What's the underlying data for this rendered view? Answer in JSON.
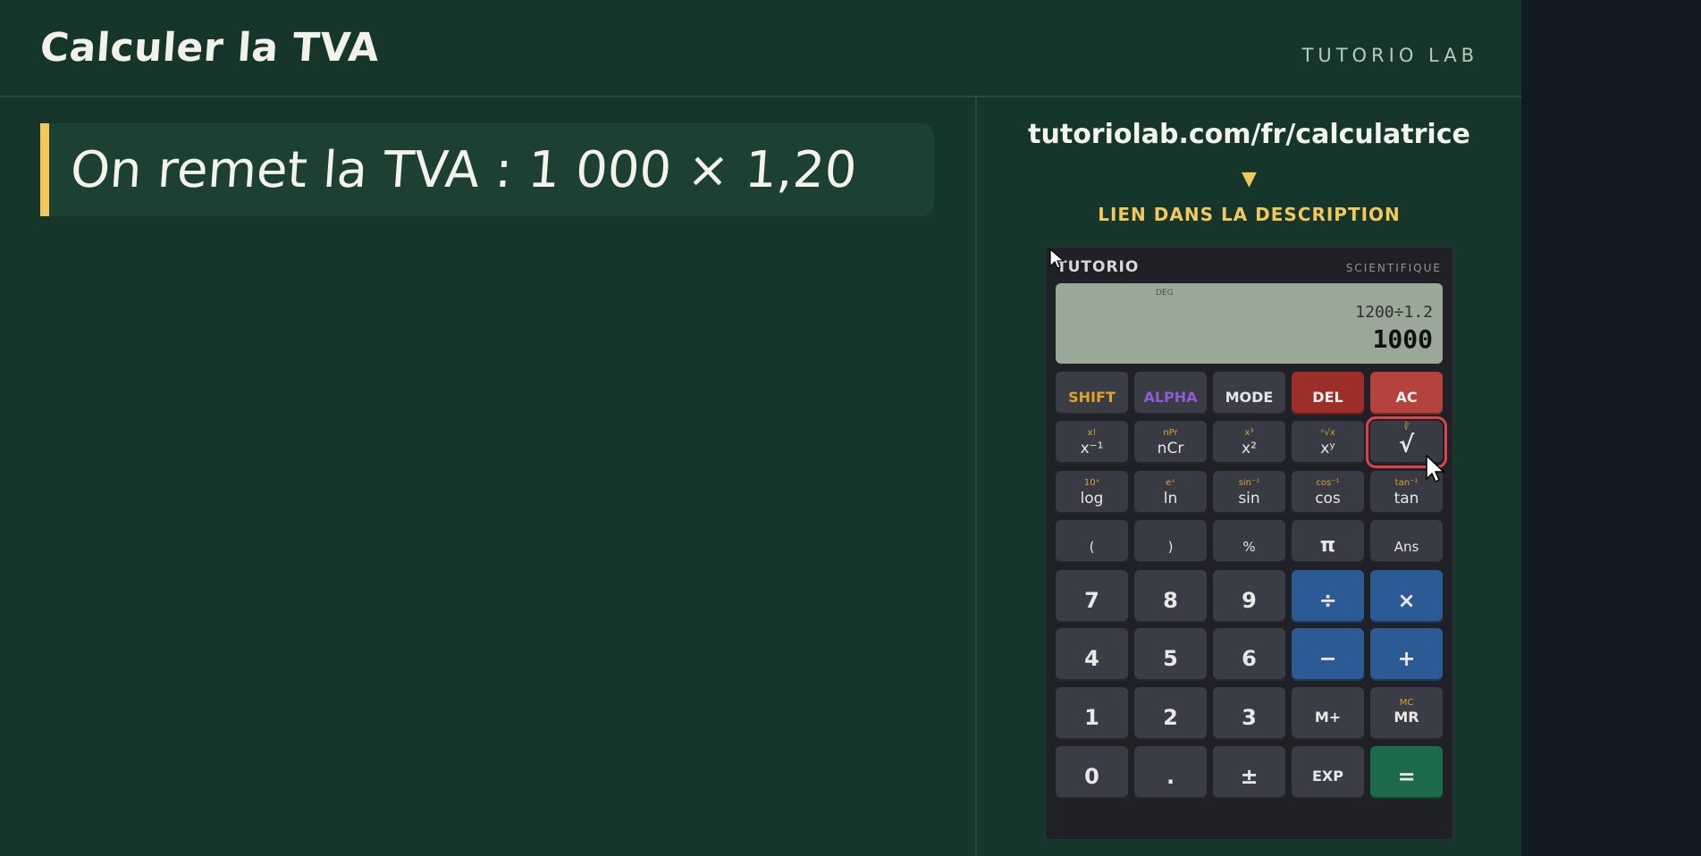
{
  "header": {
    "title": "Calculer la TVA",
    "brand": "TUTORIO LAB"
  },
  "step": {
    "text": "On remet la TVA : 1 000 × 1,20"
  },
  "promo": {
    "url": "tutoriolab.com/fr/calculatrice",
    "arrow": "▼",
    "link_label": "LIEN DANS LA DESCRIPTION"
  },
  "calculator": {
    "brand": "TUTORIO",
    "model": "SCIENTIFIQUE",
    "display": {
      "mode": "DEG",
      "expression": "1200÷1.2",
      "result": "1000"
    },
    "keys": {
      "shift": "SHIFT",
      "alpha": "ALPHA",
      "mode": "MODE",
      "del": "DEL",
      "ac": "AC",
      "inv": {
        "main": "x⁻¹",
        "sec": "x!"
      },
      "ncr": {
        "main": "nCr",
        "sec": "nPr"
      },
      "sq": {
        "main": "x²",
        "sec": "x³"
      },
      "pow": {
        "main": "xʸ",
        "sec": "ˣ√x"
      },
      "sqrt": {
        "main": "√",
        "sec": "∛"
      },
      "log": {
        "main": "log",
        "sec": "10ˣ"
      },
      "ln": {
        "main": "ln",
        "sec": "eˣ"
      },
      "sin": {
        "main": "sin",
        "sec": "sin⁻¹"
      },
      "cos": {
        "main": "cos",
        "sec": "cos⁻¹"
      },
      "tan": {
        "main": "tan",
        "sec": "tan⁻¹"
      },
      "lparen": "(",
      "rparen": ")",
      "percent": "%",
      "pi": "π",
      "ans": "Ans",
      "n7": "7",
      "n8": "8",
      "n9": "9",
      "div": "÷",
      "mul": "×",
      "n4": "4",
      "n5": "5",
      "n6": "6",
      "sub": "−",
      "add": "+",
      "n1": "1",
      "n2": "2",
      "n3": "3",
      "mplus": "M+",
      "mr": {
        "main": "MR",
        "sec": "MC"
      },
      "n0": "0",
      "dot": ".",
      "neg": "±",
      "exp": "EXP",
      "eq": "="
    }
  },
  "colors": {
    "background": "#16362c",
    "accent": "#f1c85a",
    "highlight": "#e0424a",
    "operator_key": "#2b5a94",
    "equals_key": "#1e6b4b",
    "delete_key": "#9d2e2a"
  },
  "icons": [
    "mouse-pointer-icon"
  ]
}
